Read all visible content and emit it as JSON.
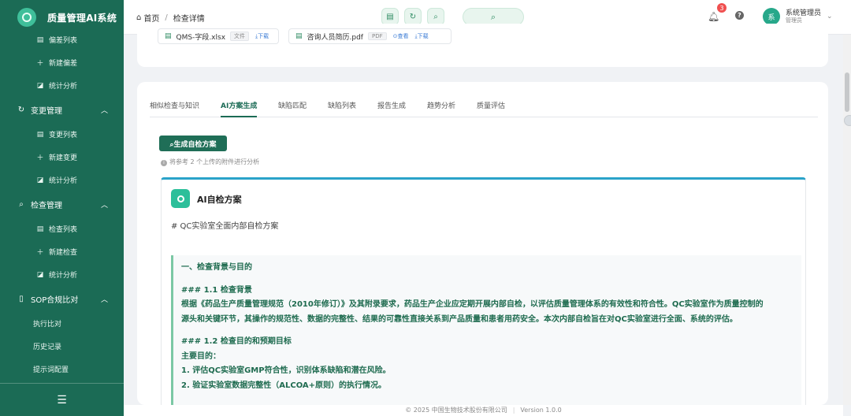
{
  "app": {
    "title": "质量管理AI系统"
  },
  "sidebar": {
    "groups": [
      {
        "label": "偏差列表",
        "icon": "list-icon"
      },
      {
        "label": "新建偏差",
        "icon": "plus-icon"
      },
      {
        "label": "统计分析",
        "icon": "chart-icon"
      },
      {
        "label": "变更管理",
        "icon": "refresh-icon"
      },
      {
        "label": "变更列表",
        "icon": "list-icon"
      },
      {
        "label": "新建变更",
        "icon": "plus-icon"
      },
      {
        "label": "统计分析",
        "icon": "chart-icon"
      },
      {
        "label": "检查管理",
        "icon": "search-icon"
      },
      {
        "label": "检查列表",
        "icon": "list-icon"
      },
      {
        "label": "新建检查",
        "icon": "plus-icon"
      },
      {
        "label": "统计分析",
        "icon": "chart-icon"
      },
      {
        "label": "SOP合规比对",
        "icon": "document-icon"
      },
      {
        "label": "执行比对"
      },
      {
        "label": "历史记录"
      },
      {
        "label": "提示词配置"
      }
    ]
  },
  "header": {
    "breadcrumb_home": "首页",
    "breadcrumb_sep": "/",
    "breadcrumb_current": "检查详情",
    "notification_count": "3",
    "help": "?",
    "user_name": "系统管理员",
    "user_role": "管理员",
    "avatar_text": "系"
  },
  "attachments": [
    {
      "name": "QMS-字段.xlsx",
      "tag": "文件",
      "action": "⤓下载"
    },
    {
      "name": "咨询人员简历.pdf",
      "tag": "PDF",
      "action_view": "⊙查看",
      "action": "⤓下载"
    }
  ],
  "tabs": [
    "相似检查与知识",
    "AI方案生成",
    "缺陷匹配",
    "缺陷列表",
    "报告生成",
    "趋势分析",
    "质量评估"
  ],
  "main": {
    "generate_button": "⌕生成自检方案",
    "hint": "将参考 2 个上传的附件进行分析",
    "ai_title": "AI自检方案",
    "md_heading": "# QC实验室全面内部自检方案",
    "lines": [
      "一、检查背景与目的",
      "",
      "### 1.1 检查背景",
      "根据《药品生产质量管理规范（2010年修订）》及其附录要求，药品生产企业应定期开展内部自检，以评估质量管理体系的有效性和符合性。QC实验室作为质量控制的",
      "源头和关键环节，其操作的规范性、数据的完整性、结果的可靠性直接关系到产品质量和患者用药安全。本次内部自检旨在对QC实验室进行全面、系统的评估。",
      "",
      "### 1.2 检查目的和预期目标",
      "主要目的：",
      "1. 评估QC实验室GMP符合性，识别体系缺陷和潜在风险。",
      "2. 验证实验室数据完整性（ALCOA+原则）的执行情况。"
    ]
  },
  "footer": {
    "copyright": "© 2025 中国生物技术股份有限公司",
    "version": "Version 1.0.0"
  },
  "colors": {
    "sidebar": "#1b6b55",
    "accent": "#2e8b62",
    "ai_border": "#2aa3c9"
  }
}
